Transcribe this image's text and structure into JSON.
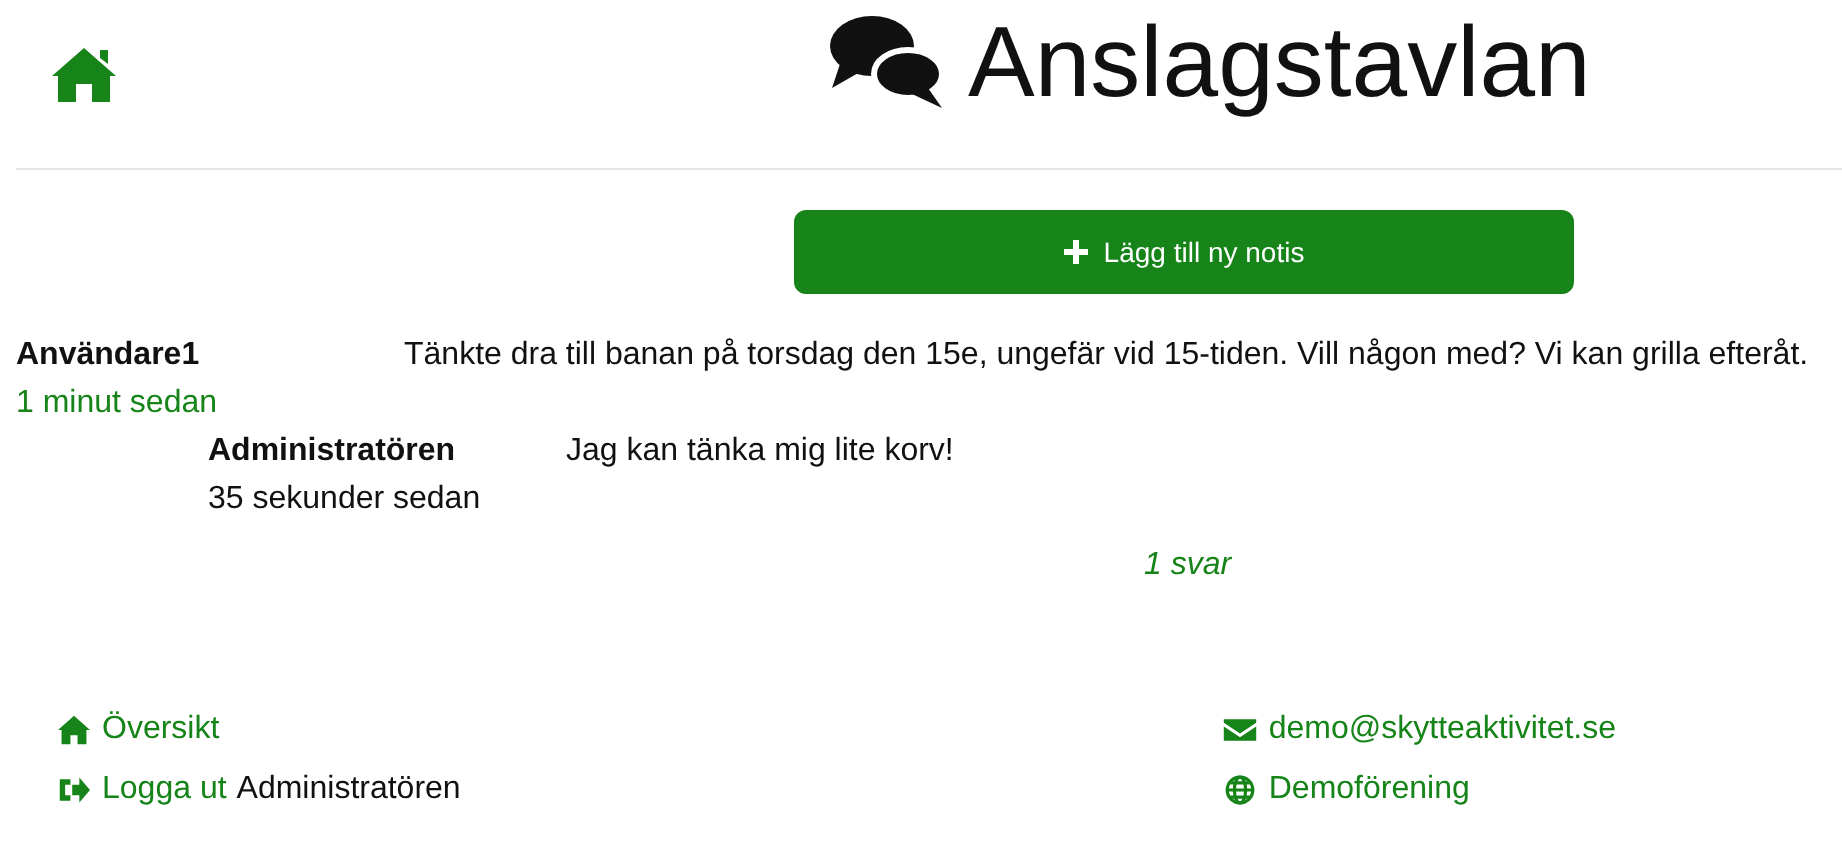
{
  "header": {
    "title": "Anslagstavlan"
  },
  "add_button": {
    "label": "Lägg till ny notis"
  },
  "posts": [
    {
      "author": "Användare1",
      "time": "1 minut sedan",
      "text": "Tänkte dra till banan på torsdag den 15e, ungefär vid 15-tiden. Vill någon med? Vi kan grilla efteråt.",
      "replies": [
        {
          "author": "Administratören",
          "time": "35 sekunder sedan",
          "text": "Jag kan tänka mig lite korv!"
        }
      ],
      "reply_count": "1 svar"
    }
  ],
  "footer": {
    "left": [
      {
        "kind": "home",
        "link": "Översikt"
      },
      {
        "kind": "logout",
        "link": "Logga ut",
        "text": "Administratören"
      }
    ],
    "right": [
      {
        "kind": "mail",
        "link": "demo@skytteaktivitet.se"
      },
      {
        "kind": "globe",
        "link": "Demoförening"
      }
    ]
  }
}
